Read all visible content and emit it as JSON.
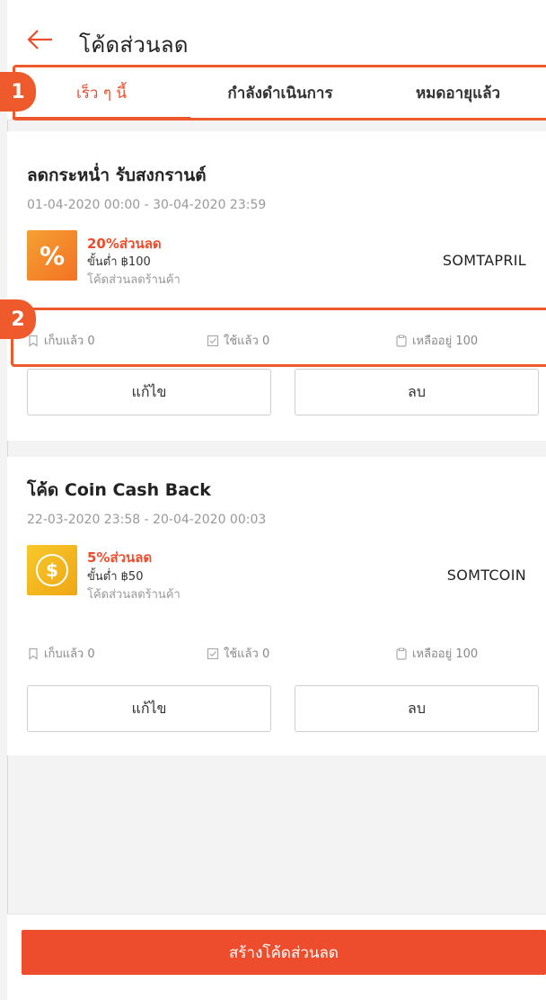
{
  "header": {
    "title": "โค้ดส่วนลด",
    "back_icon": "arrow-left-icon"
  },
  "tabs": [
    {
      "label": "เร็ว ๆ นี้",
      "active": true
    },
    {
      "label": "กำลังดำเนินการ",
      "active": false
    },
    {
      "label": "หมดอายุแล้ว",
      "active": false
    }
  ],
  "markers": [
    "1",
    "2"
  ],
  "vouchers": [
    {
      "title": "ลดกระหน่ำ รับสงกรานต์",
      "dates": "01-04-2020 00:00 - 30-04-2020 23:59",
      "icon": "percent-icon",
      "icon_glyph": "%",
      "discount": "20%ส่วนลด",
      "min_spend": "ขั้นต่ำ ฿100",
      "type": "โค้ดส่วนลดร้านค้า",
      "code": "SOMTAPRIL",
      "claimed": "เก็บแล้ว 0",
      "used": "ใช้แล้ว 0",
      "remaining": "เหลืออยู่ 100",
      "edit_label": "แก้ไข",
      "delete_label": "ลบ"
    },
    {
      "title": "โค้ด Coin Cash Back",
      "dates": "22-03-2020 23:58 - 20-04-2020 00:03",
      "icon": "coin-dollar-icon",
      "icon_glyph": "$",
      "discount": "5%ส่วนลด",
      "min_spend": "ขั้นต่ำ ฿50",
      "type": "โค้ดส่วนลดร้านค้า",
      "code": "SOMTCOIN",
      "claimed": "เก็บแล้ว 0",
      "used": "ใช้แล้ว 0",
      "remaining": "เหลืออยู่ 100",
      "edit_label": "แก้ไข",
      "delete_label": "ลบ"
    }
  ],
  "footer": {
    "create_label": "สร้างโค้ดส่วนลด"
  },
  "colors": {
    "accent": "#ee4d2d",
    "annotation": "#ee5a2b"
  }
}
